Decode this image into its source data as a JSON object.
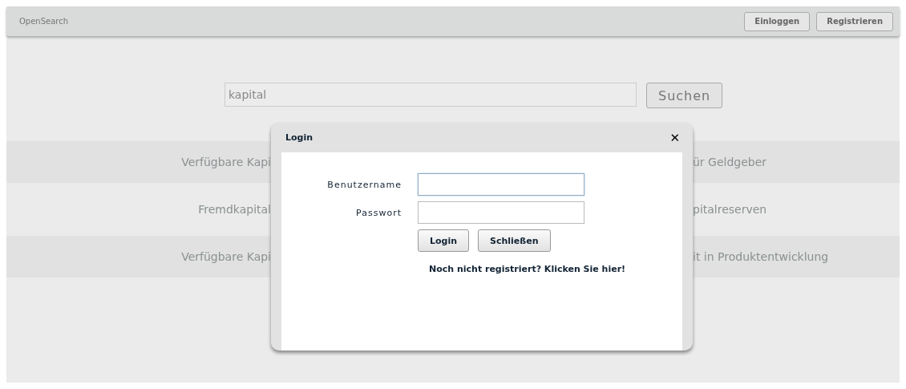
{
  "header": {
    "brand": "OpenSearch",
    "buttons": [
      "Einloggen",
      "Registrieren"
    ]
  },
  "search": {
    "value": "kapital",
    "button": "Suchen"
  },
  "results": [
    {
      "left": "Verfügbare Kapi",
      "right": "ür Geldgeber"
    },
    {
      "left": "Fremdkapital",
      "right": "pitalreserven"
    },
    {
      "left": "Verfügbare Kapi",
      "right": "it in Produktentwicklung"
    }
  ],
  "dialog": {
    "title": "Login",
    "close": "✕",
    "fields": [
      {
        "label": "Benutzername",
        "focused": true
      },
      {
        "label": "Passwort",
        "focused": false
      }
    ],
    "buttons": [
      "Login",
      "Schließen"
    ],
    "register_link": "Noch nicht registriert? Klicken Sie hier!"
  }
}
